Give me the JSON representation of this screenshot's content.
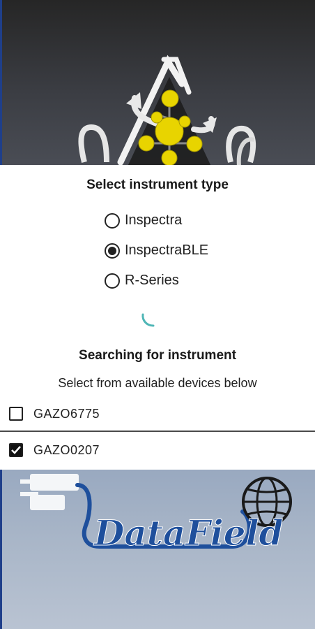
{
  "dialog": {
    "title": "Select instrument type",
    "instrument_types": [
      {
        "label": "Inspectra",
        "selected": false
      },
      {
        "label": "InspectraBLE",
        "selected": true
      },
      {
        "label": "R-Series",
        "selected": false
      }
    ],
    "status": "Searching for instrument",
    "hint": "Select from available devices below",
    "devices": [
      {
        "label": "GAZO6775",
        "checked": false
      },
      {
        "label": "GAZO0207",
        "checked": true
      }
    ]
  },
  "branding": {
    "logo_text": "DataField"
  },
  "colors": {
    "accent": "#4fb6b6",
    "logo_blue": "#1e4f9c",
    "molecule_yellow": "#e8d400"
  }
}
